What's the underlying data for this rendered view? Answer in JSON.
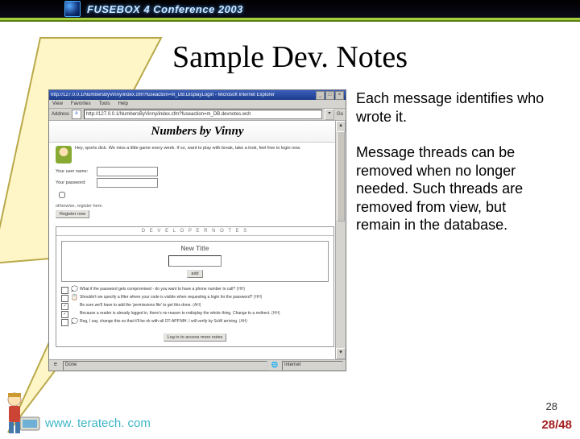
{
  "banner": {
    "text": "FUSEBOX 4 Conference 2003"
  },
  "title": "Sample Dev. Notes",
  "explain": {
    "p1": "Each message identifies who wrote it.",
    "p2a": "Message threads can be removed when no longer",
    "p2b": "needed. Such threads are removed from view, but",
    "p2c": "remain in the database."
  },
  "browser": {
    "winTitle": "http://127.0.0.1/NumbersByVinny/index.cfm?fuseaction=m_DB.DisplayLogin - Microsoft Internet Explorer",
    "menu": [
      "View",
      "Favorites",
      "Tools",
      "Help"
    ],
    "addrLabel": "Address",
    "addrIcon": "e",
    "url": "http://127.0.0.1/NumbersByVinny/index.cfm?fuseaction=m_DB.devnotes.wch",
    "go": "Go",
    "pageTitle": "Numbers by Vinny",
    "intro": "Hey, sports dick. We miss a little game every week. If so, want to play with break, take a look, feel free to login now.",
    "form": {
      "userLabel": "Your user name:",
      "passLabel": "Your password:",
      "otherwise": "otherwise, register here.",
      "registerBtn": "Register now"
    },
    "dev": {
      "boxTitle": "D E V E L O P E R   N O T E S",
      "newTitle": "New Title",
      "addBtn": "add",
      "items": [
        {
          "chk": "",
          "ico": "💭",
          "t": "What if the password gets compromised - do you want to have a phone number to call?",
          "a": "(HH)"
        },
        {
          "chk": "",
          "ico": "📋",
          "t": "Shouldn't we specify a filter where your code is visible when requesting a login for the password?",
          "a": "(HH)"
        },
        {
          "chk": "✓",
          "ico": "",
          "t": "Be sure we'll have to add the 'permissions file' to get this done.",
          "a": "(AH)"
        },
        {
          "chk": "✓",
          "ico": "",
          "t": "Because a reader is already logged in, there's no reason to redisplay the whole thing. Change to a redirect.",
          "a": "(HH)"
        },
        {
          "chk": "",
          "ico": "💭",
          "t": "Reg, I say, change this so that it'll be ok with all OT-APP.MH. I will verify by SoW arriving.",
          "a": "(AH)"
        }
      ],
      "loginBtn": "Log in to access more notes"
    },
    "status": {
      "done": "Done",
      "zone": "Internet"
    }
  },
  "footer": {
    "url": "www. teratech. com",
    "page": "28",
    "counter": "28/48"
  }
}
